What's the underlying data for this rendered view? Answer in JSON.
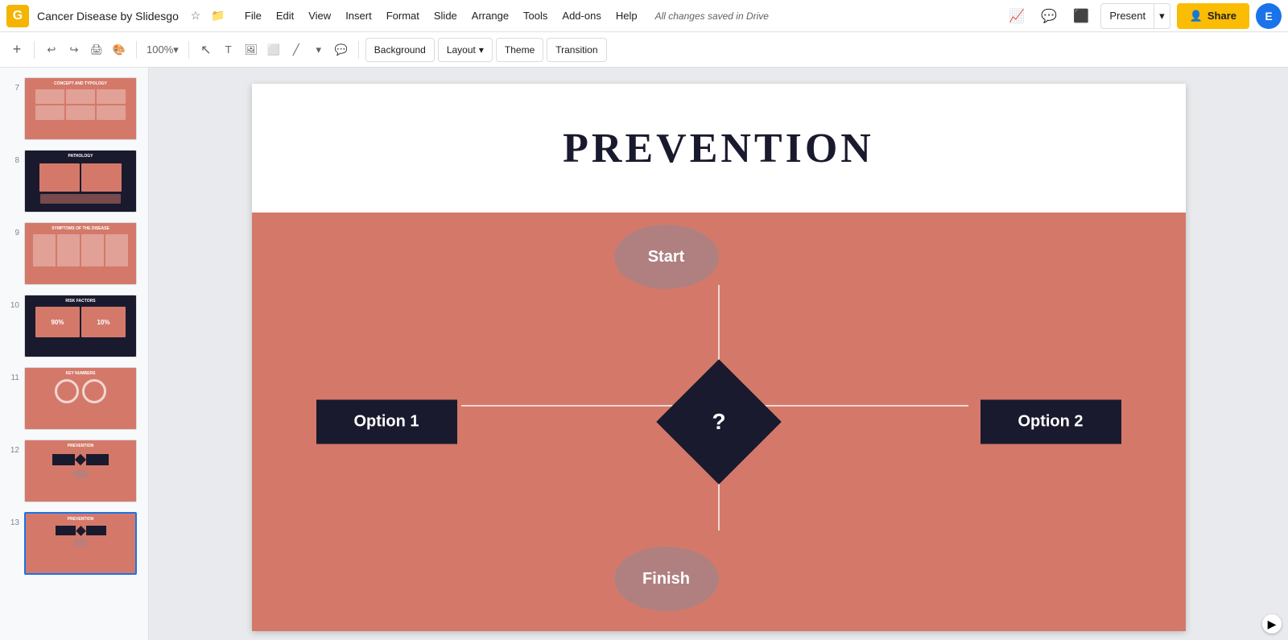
{
  "app": {
    "icon": "G",
    "title": "Cancer Disease by Slidesgo",
    "saved_status": "All changes saved in Drive"
  },
  "menu": {
    "items": [
      "File",
      "Edit",
      "View",
      "Insert",
      "Format",
      "Slide",
      "Arrange",
      "Tools",
      "Add-ons",
      "Help"
    ]
  },
  "toolbar": {
    "background_label": "Background",
    "layout_label": "Layout",
    "theme_label": "Theme",
    "transition_label": "Transition",
    "zoom_level": "100%"
  },
  "header": {
    "present_label": "Present",
    "share_label": "Share",
    "avatar_initial": "E"
  },
  "slides": [
    {
      "num": 7,
      "theme": "salmon",
      "title": "CONCEPT AND TYPOLOGY"
    },
    {
      "num": 8,
      "theme": "dark",
      "title": "PATHOLOGY"
    },
    {
      "num": 9,
      "theme": "salmon",
      "title": "SYMPTOMS OF THE DISEASE"
    },
    {
      "num": 10,
      "theme": "dark",
      "title": "RISK FACTORS"
    },
    {
      "num": 11,
      "theme": "salmon",
      "title": "KEY NUMBERS"
    },
    {
      "num": 12,
      "theme": "salmon",
      "title": "PREVENTION"
    },
    {
      "num": 13,
      "theme": "salmon",
      "title": "PREVENTION",
      "active": true
    }
  ],
  "current_slide": {
    "title": "PREVENTION",
    "flowchart": {
      "start_label": "Start",
      "finish_label": "Finish",
      "decision_label": "?",
      "option1_label": "Option 1",
      "option2_label": "Option 2"
    }
  }
}
